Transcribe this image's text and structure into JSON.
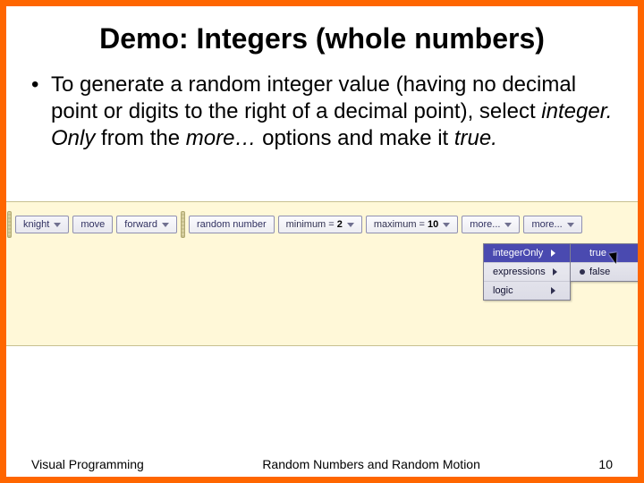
{
  "title": "Demo: Integers (whole numbers)",
  "bullet": {
    "pre": "To generate a random integer value (having no decimal point or digits to the right of a decimal point), select ",
    "em1": "integer. Only",
    "mid": " from the ",
    "em2": "more…",
    "post": " options and make it ",
    "em3": "true.",
    "tail": ""
  },
  "tiles": {
    "knight": "knight",
    "move": "move",
    "forward": "forward",
    "random_number": "random number",
    "min_label": "minimum =",
    "min_val": "2",
    "max_label": "maximum =",
    "max_val": "10",
    "more": "more...",
    "more2": "more..."
  },
  "menu_main": {
    "integer_only": "integerOnly",
    "expressions": "expressions",
    "logic": "logic"
  },
  "menu_sub": {
    "true": "true",
    "false": "false"
  },
  "footer": {
    "left": "Visual Programming",
    "center": "Random Numbers and Random Motion",
    "right": "10"
  }
}
